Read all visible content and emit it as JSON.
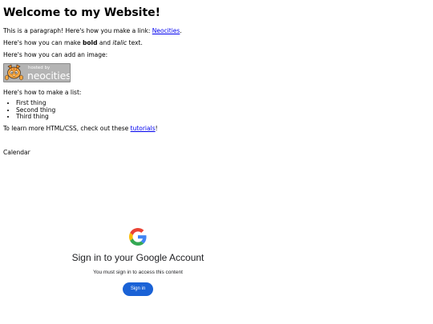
{
  "page": {
    "heading": "Welcome to my Website!",
    "intro_prefix": "This is a paragraph! Here's how you make a link: ",
    "intro_link": "Neocities",
    "intro_suffix": ".",
    "format_prefix": "Here's how you can make ",
    "format_bold": "bold",
    "format_mid": " and ",
    "format_italic": "italic",
    "format_suffix": " text.",
    "image_text": "Here's how you can add an image:",
    "list_intro": "Here's how to make a list:",
    "list_items": [
      "First thing",
      "Second thing",
      "Third thing"
    ],
    "learn_prefix": "To learn more HTML/CSS, check out these ",
    "learn_link": "tutorials",
    "learn_suffix": "!",
    "calendar_label": "Calendar"
  },
  "badge": {
    "small_text": "hosted by",
    "big_text": "neocities"
  },
  "signin": {
    "title": "Sign in to your Google Account",
    "subtitle": "You must sign in to access this content",
    "button_label": "Sign in"
  },
  "colors": {
    "link": "#0000ee",
    "signin_button": "#1a62d6",
    "badge_bg": "#b4b4b4"
  },
  "icons": {
    "badge_mascot": "neocities-cat-icon",
    "google_logo": "google-g-icon"
  }
}
